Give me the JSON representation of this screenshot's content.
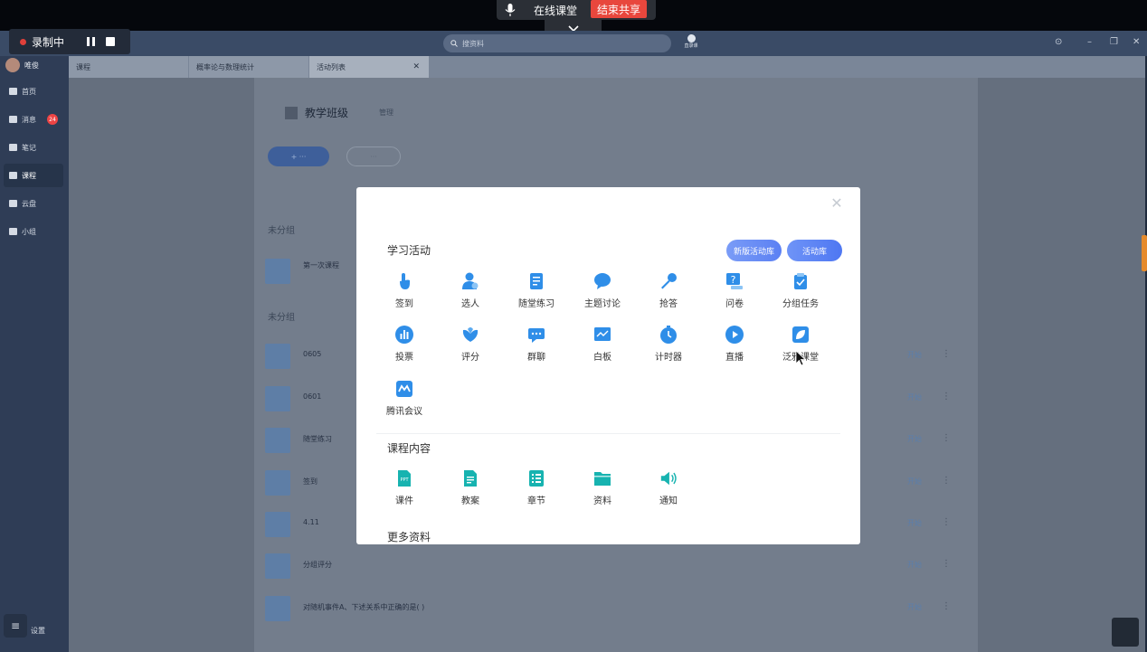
{
  "topbar": {
    "share_title": "在线课堂",
    "end_share_label": "结束共享"
  },
  "recording": {
    "label": "录制中"
  },
  "header": {
    "search_placeholder": "搜资料",
    "record_label": "直录课"
  },
  "sidebar": {
    "user_name": "唯俊",
    "items": [
      {
        "label": "首页"
      },
      {
        "label": "消息",
        "badge": "24"
      },
      {
        "label": "笔记"
      },
      {
        "label": "课程"
      },
      {
        "label": "云盘"
      },
      {
        "label": "小组"
      }
    ],
    "settings_label": "设置"
  },
  "tabs": [
    {
      "label": "课程"
    },
    {
      "label": "概率论与数理统计"
    },
    {
      "label": "活动列表"
    }
  ],
  "page": {
    "title": "教学班级",
    "manage_label": "管理",
    "group_a": "未分组",
    "group_b": "未分组",
    "first_item": "第一次课程",
    "rows": [
      {
        "title": "0605",
        "action": "开始"
      },
      {
        "title": "0601",
        "action": "开始"
      },
      {
        "title": "随堂练习",
        "action": "开始"
      },
      {
        "title": "签到",
        "action": "开始"
      },
      {
        "title": "4.11",
        "action": "开始"
      },
      {
        "title": "分组评分",
        "action": "开始"
      },
      {
        "title": "对随机事件A、下述关系中正确的是( )",
        "action": "开始"
      }
    ]
  },
  "modal": {
    "section_learning": "学习活动",
    "new_library_label": "新版活动库",
    "library_label": "活动库",
    "learning_items": [
      {
        "label": "签到",
        "icon": "hand-icon"
      },
      {
        "label": "选人",
        "icon": "person-icon"
      },
      {
        "label": "随堂练习",
        "icon": "exercise-icon"
      },
      {
        "label": "主题讨论",
        "icon": "chat-icon"
      },
      {
        "label": "抢答",
        "icon": "mic-icon"
      },
      {
        "label": "问卷",
        "icon": "question-icon"
      },
      {
        "label": "分组任务",
        "icon": "clipboard-icon"
      },
      {
        "label": "投票",
        "icon": "chart-icon"
      },
      {
        "label": "评分",
        "icon": "flower-icon"
      },
      {
        "label": "群聊",
        "icon": "group-chat-icon"
      },
      {
        "label": "白板",
        "icon": "whiteboard-icon"
      },
      {
        "label": "计时器",
        "icon": "timer-icon"
      },
      {
        "label": "直播",
        "icon": "play-icon"
      },
      {
        "label": "泛雅课堂",
        "icon": "leaf-icon"
      },
      {
        "label": "腾讯会议",
        "icon": "meeting-icon"
      }
    ],
    "section_content": "课程内容",
    "content_items": [
      {
        "label": "课件",
        "icon": "ppt-icon"
      },
      {
        "label": "教案",
        "icon": "doc-icon"
      },
      {
        "label": "章节",
        "icon": "list-icon"
      },
      {
        "label": "资料",
        "icon": "folder-icon"
      },
      {
        "label": "通知",
        "icon": "speaker-icon"
      }
    ],
    "section_more": "更多资料"
  },
  "colors": {
    "blue": "#2f8ee8",
    "teal": "#17b3b0",
    "gradient_start": "#6f94f7",
    "gradient_end": "#4e77f2"
  }
}
